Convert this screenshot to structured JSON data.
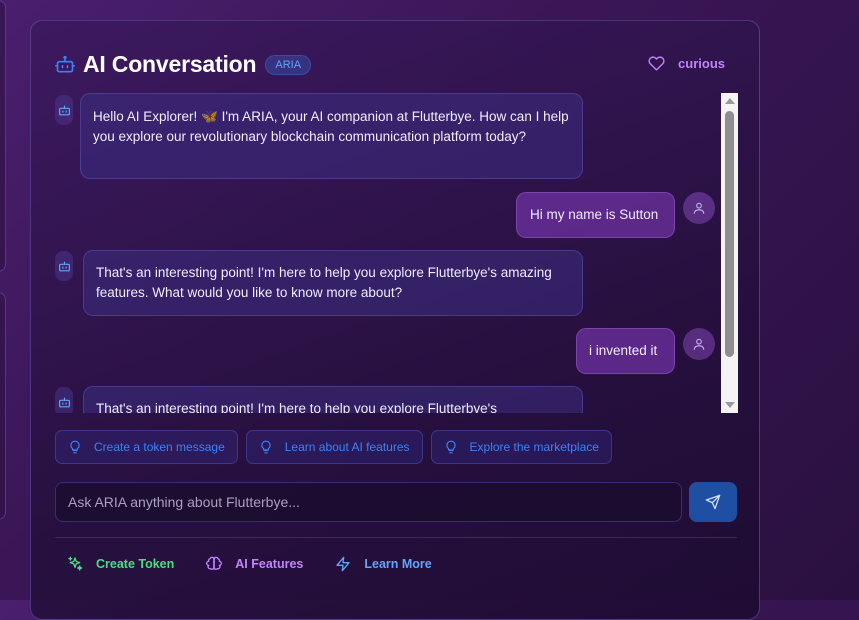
{
  "header": {
    "title": "AI Conversation",
    "badge": "ARIA",
    "mood": "curious"
  },
  "messages": [
    {
      "role": "assistant",
      "text": "Hello AI Explorer! 🦋 I'm ARIA, your AI companion at Flutterbye. How can I help you explore our revolutionary blockchain communication platform today?"
    },
    {
      "role": "user",
      "text": "Hi my name is Sutton"
    },
    {
      "role": "assistant",
      "text": "That's an interesting point! I'm here to help you explore Flutterbye's amazing features. What would you like to know more about?"
    },
    {
      "role": "user",
      "text": "i invented it"
    },
    {
      "role": "assistant",
      "text": "That's an interesting point! I'm here to help you explore Flutterbye's"
    }
  ],
  "suggestions": [
    "Create a token message",
    "Learn about AI features",
    "Explore the marketplace"
  ],
  "input": {
    "placeholder": "Ask ARIA anything about Flutterbye..."
  },
  "quick_actions": [
    "Create Token",
    "AI Features",
    "Learn More"
  ],
  "colors": {
    "accent_blue": "#3b82f6",
    "accent_purple": "#c084fc",
    "accent_green": "#4ade80",
    "send_button": "#1e4fa3"
  },
  "icons": {
    "header": "bot-icon",
    "mood": "heart-icon",
    "send": "send-icon",
    "suggestion": "lightbulb-icon",
    "quick": [
      "sparkles-icon",
      "brain-icon",
      "zap-icon"
    ]
  }
}
